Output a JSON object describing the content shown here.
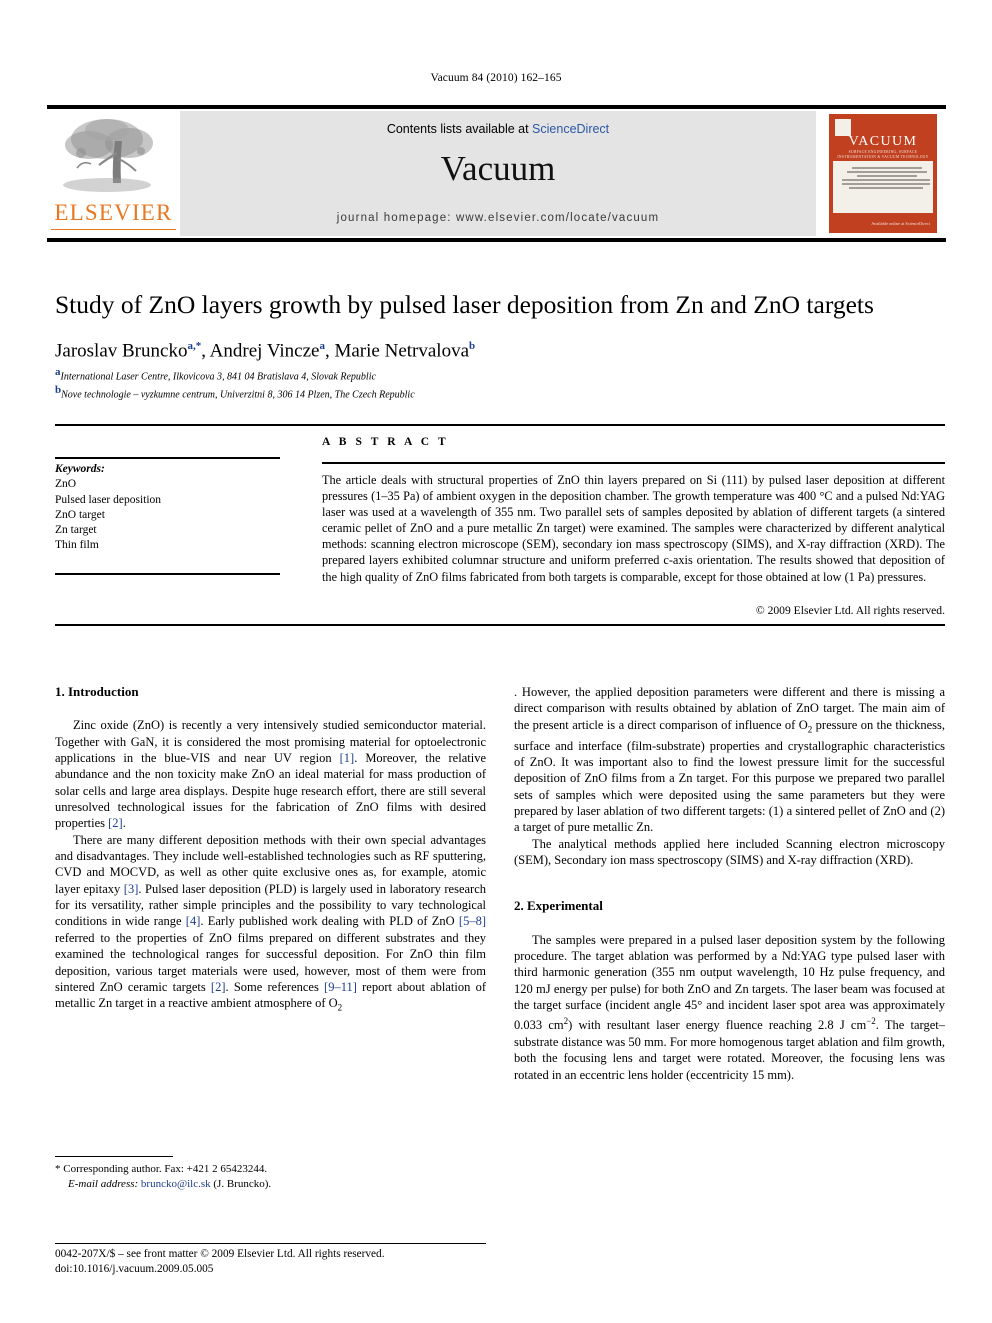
{
  "running_head": "Vacuum 84 (2010) 162–165",
  "masthead": {
    "contents_prefix": "Contents lists available at ",
    "sciencedirect": "ScienceDirect",
    "journal_name": "Vacuum",
    "homepage": "journal homepage: www.elsevier.com/locate/vacuum",
    "publisher_wordmark": "ELSEVIER",
    "publisher_logo_icon": "elsevier-tree-logo",
    "cover": {
      "title": "VACUUM",
      "subtitle": "SURFACE ENGINEERING, SURFACE INSTRUMENTATION & VACUUM TECHNOLOGY",
      "footer": "Available online at\nScienceDirect"
    },
    "accent_color": "#e87722",
    "cover_color": "#c0401f",
    "link_color": "#2b57a7"
  },
  "article": {
    "title": "Study of ZnO layers growth by pulsed laser deposition from Zn and ZnO targets",
    "authors": [
      {
        "name": "Jaroslav Bruncko",
        "marks": "a,*"
      },
      {
        "name": "Andrej Vincze",
        "marks": "a"
      },
      {
        "name": "Marie Netrvalova",
        "marks": "b"
      }
    ],
    "affiliations": [
      {
        "mark": "a",
        "text": "International Laser Centre, Ilkovicova 3, 841 04 Bratislava 4, Slovak Republic"
      },
      {
        "mark": "b",
        "text": "Nove technologie – vyzkumne centrum, Univerzitni 8, 306 14 Plzen, The Czech Republic"
      }
    ]
  },
  "keywords": {
    "heading": "Keywords:",
    "items": [
      "ZnO",
      "Pulsed laser deposition",
      "ZnO target",
      "Zn target",
      "Thin film"
    ]
  },
  "abstract": {
    "heading": "A B S T R A C T",
    "text": "The article deals with structural properties of ZnO thin layers prepared on Si (111) by pulsed laser deposition at different pressures (1–35 Pa) of ambient oxygen in the deposition chamber. The growth temperature was 400 °C and a pulsed Nd:YAG laser was used at a wavelength of 355 nm. Two parallel sets of samples deposited by ablation of different targets (a sintered ceramic pellet of ZnO and a pure metallic Zn target) were examined. The samples were characterized by different analytical methods: scanning electron microscope (SEM), secondary ion mass spectroscopy (SIMS), and X-ray diffraction (XRD). The prepared layers exhibited columnar structure and uniform preferred c-axis orientation. The results showed that deposition of the high quality of ZnO films fabricated from both targets is comparable, except for those obtained at low (1 Pa) pressures.",
    "copyright": "© 2009 Elsevier Ltd. All rights reserved."
  },
  "body": {
    "section1_heading": "1. Introduction",
    "section2_heading": "2. Experimental",
    "p1_a": "Zinc oxide (ZnO) is recently a very intensively studied semiconductor material. Together with GaN, it is considered the most promising material for optoelectronic applications in the blue-VIS and near UV region ",
    "p1_ref1": "[1]",
    "p1_b": ". Moreover, the relative abundance and the non toxicity make ZnO an ideal material for mass production of solar cells and large area displays. Despite huge research effort, there are still several unresolved technological issues for the fabrication of ZnO films with desired properties ",
    "p1_ref2": "[2]",
    "p1_c": ".",
    "p2_a": "There are many different deposition methods with their own special advantages and disadvantages. They include well-established technologies such as RF sputtering, CVD and MOCVD, as well as other quite exclusive ones as, for example, atomic layer epitaxy ",
    "p2_ref3": "[3]",
    "p2_b": ". Pulsed laser deposition (PLD) is largely used in laboratory research for its versatility, rather simple principles and the possibility to vary technological conditions in wide range ",
    "p2_ref4": "[4]",
    "p2_c": ". Early published work dealing with PLD of ZnO ",
    "p2_ref5": "[5–8]",
    "p2_d": " referred to the properties of ZnO films prepared on different substrates and they examined the technological ranges for successful deposition. For ZnO thin film deposition, various target materials were used, however, most of them were from sintered ZnO ceramic targets ",
    "p2_ref6": "[2]",
    "p2_e": ". Some references ",
    "p2_ref7": "[9–11]",
    "p2_f": " report about ablation of metallic Zn target in a reactive ambient atmosphere of O",
    "p2_sub": "2",
    "p2_g": ". However, the applied deposition parameters were different and there is missing a direct comparison with results obtained by ablation of ZnO target. The main aim of the present article is a direct comparison of influence of O",
    "p2_sub2": "2",
    "p2_h": " pressure on the thickness, surface and interface (film-substrate) properties and crystallographic characteristics of ZnO. It was important also to find the lowest pressure limit for the successful deposition of ZnO films from a Zn target. For this purpose we prepared two parallel sets of samples which were deposited using the same parameters but they were prepared by laser ablation of two different targets: (1) a sintered pellet of ZnO and (2) a target of pure metallic Zn.",
    "p3": "The analytical methods applied here included Scanning electron microscopy (SEM), Secondary ion mass spectroscopy (SIMS) and X-ray diffraction (XRD).",
    "p4_a": "The samples were prepared in a pulsed laser deposition system by the following procedure. The target ablation was performed by a Nd:YAG type pulsed laser with third harmonic generation (355 nm output wavelength, 10 Hz pulse frequency, and 120 mJ energy per pulse) for both ZnO and Zn targets. The laser beam was focused at the target surface (incident angle 45° and incident laser spot area was approximately 0.033 cm",
    "p4_sup1": "2",
    "p4_b": ") with resultant laser energy fluence reaching 2.8 J cm",
    "p4_sup2": "−2",
    "p4_c": ". The target–substrate distance was 50 mm. For more homogenous target ablation and film growth, both the focusing lens and target were rotated. Moreover, the focusing lens was rotated in an eccentric lens holder (eccentricity 15 mm)."
  },
  "footnotes": {
    "corresponding": "* Corresponding author. Fax: +421 2 65423244.",
    "email_label": "E-mail address:",
    "email": "bruncko@ilc.sk",
    "email_suffix": "(J. Bruncko).",
    "issn_line": "0042-207X/$ – see front matter © 2009 Elsevier Ltd. All rights reserved.",
    "doi_line": "doi:10.1016/j.vacuum.2009.05.005"
  }
}
